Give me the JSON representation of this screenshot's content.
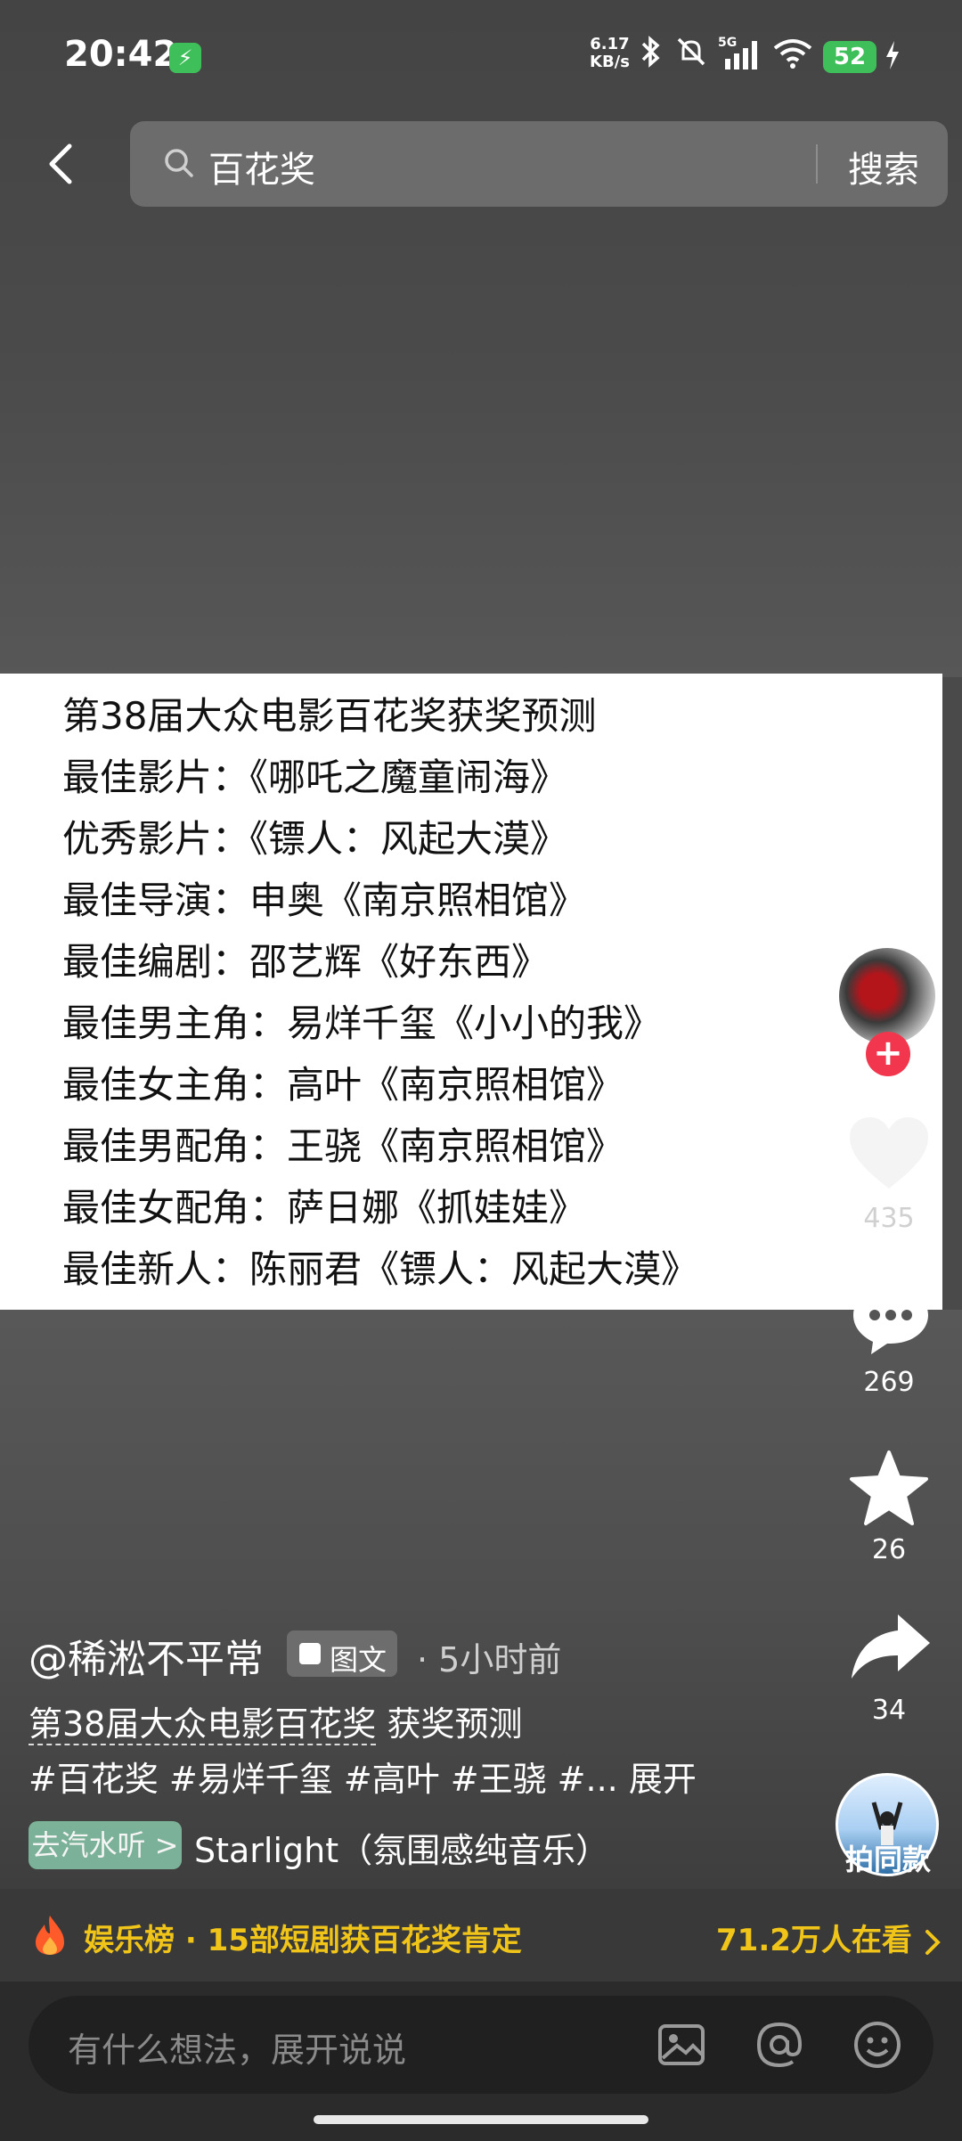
{
  "status_bar": {
    "time": "20:42",
    "net_speed_top": "6.17",
    "net_speed_unit": "KB/s",
    "signal_label": "5G",
    "battery": "52"
  },
  "search": {
    "query": "百花奖",
    "button": "搜索"
  },
  "card": {
    "lines": [
      "第38届大众电影百花奖获奖预测",
      "最佳影片：《哪吒之魔童闹海》",
      "优秀影片：《镖人：风起大漠》",
      "最佳导演：申奥《南京照相馆》",
      "最佳编剧：邵艺辉《好东西》",
      "最佳男主角：易烊千玺《小小的我》",
      "最佳女主角：高叶《南京照相馆》",
      "最佳男配角：王骁《南京照相馆》",
      "最佳女配角：萨日娜《抓娃娃》",
      "最佳新人：陈丽君《镖人：风起大漠》"
    ]
  },
  "actions": {
    "likes": "435",
    "comments": "269",
    "favorites": "26",
    "shares": "34",
    "same_style": "拍同款"
  },
  "post": {
    "author": "@稀淞不平常",
    "type_badge": "图文",
    "time_ago": "· 5小时前",
    "desc_linked": "第38届大众电影百花奖",
    "desc_rest": " 获奖预测",
    "hashtags": "#百花奖 #易烊千玺 #高叶 #王骁 #... 展开",
    "music_button": "去汽水听 >",
    "music_title": "Starlight（氛围感纯音乐）"
  },
  "trending": {
    "text": "娱乐榜 · 15部短剧获百花奖肯定",
    "viewers": "71.2万人在看"
  },
  "comment_input": {
    "placeholder": "有什么想法，展开说说"
  },
  "colors": {
    "accent_yellow": "#f0c419",
    "follow_red": "#f2364e",
    "battery_green": "#3fbf5a"
  }
}
